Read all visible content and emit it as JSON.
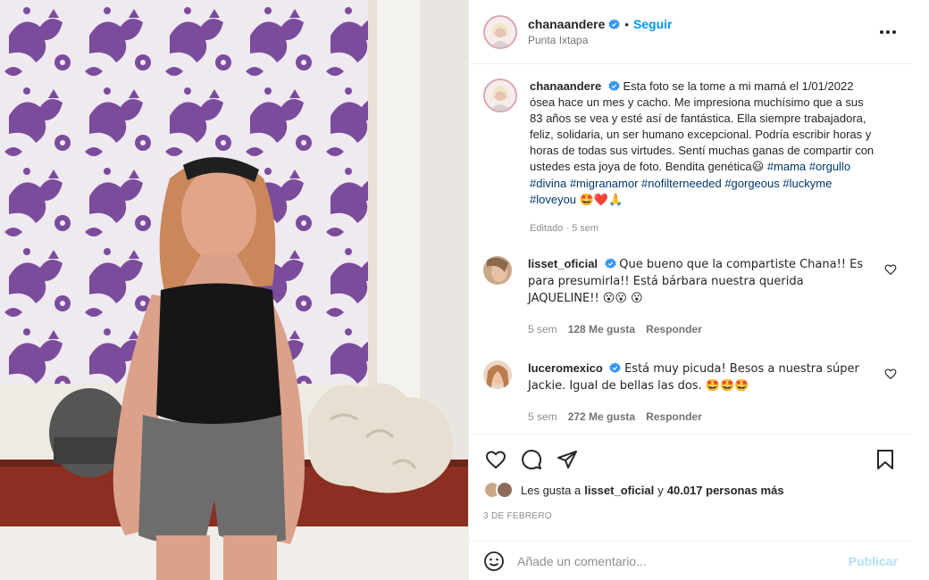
{
  "post": {
    "author": {
      "username": "chanaandere",
      "follow_label": "Seguir",
      "location": "Punta Ixtapa"
    },
    "caption": {
      "text": "Esta foto se la tome a mi mamá el 1/01/2022 ósea hace un mes y cacho. Me impresiona muchísimo que a sus 83 años se vea y esté así de fantástica. Ella siempre trabajadora, feliz, solidaria, un ser humano excepcional. Podría escribir horas y horas de todas sus virtudes. Sentí muchas ganas de compartir con ustedes esta joya de foto. Bendita genética",
      "emoji_after_text": "😃",
      "hashtags": [
        "#mama",
        "#orgullo",
        "#divina",
        "#migranamor",
        "#nofilterneeded",
        "#gorgeous",
        "#luckyme",
        "#loveyou"
      ],
      "trailing_emojis": "🤩❤️🙏",
      "meta": "Editado · 5 sem"
    },
    "comments": [
      {
        "username": "lisset_oficial",
        "text": "Que bueno que la compartiste Chana!! Es para presumirla!! Está bárbara nuestra querida JAQUELINE!! 😮😮 😮",
        "time": "5 sem",
        "likes": "128 Me gusta",
        "reply": "Responder"
      },
      {
        "username": "luceromexico",
        "text": "Está muy picuda! Besos a nuestra súper Jackie. Igual de bellas las dos. 🤩🤩🤩",
        "time": "5 sem",
        "likes": "272 Me gusta",
        "reply": "Responder"
      }
    ],
    "likes_summary": {
      "prefix": "Les gusta a",
      "user": "lisset_oficial",
      "middle": "y",
      "count": "40.017 personas más"
    },
    "date": "3 DE FEBRERO",
    "add_comment": {
      "placeholder": "Añade un comentario...",
      "publish_label": "Publicar"
    }
  },
  "icons": {
    "verified": "verified-badge-icon",
    "more": "more-options-icon",
    "like": "heart-icon",
    "comment": "comment-icon",
    "share": "share-icon",
    "save": "bookmark-icon",
    "emoji": "emoji-icon"
  },
  "colors": {
    "link_blue": "#0095f6",
    "hashtag": "#00376b",
    "verified": "#3897f0",
    "secondary_text": "#8e8e8e",
    "wallpaper_purple": "#7b4c9c"
  }
}
